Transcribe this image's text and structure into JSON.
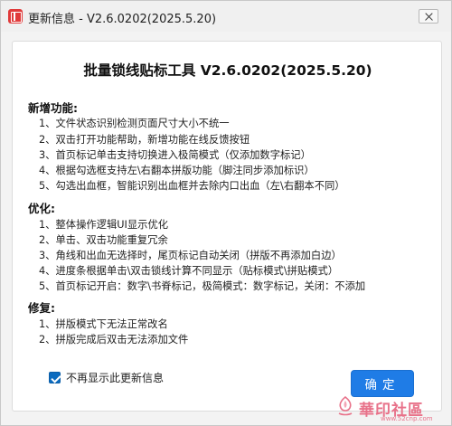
{
  "window": {
    "title": "更新信息 - V2.6.0202(2025.5.20)"
  },
  "heading": "批量锁线贴标工具 V2.6.0202(2025.5.20)",
  "sections": [
    {
      "title": "新增功能:",
      "items": [
        "1、文件状态识别检测页面尺寸大小不统一",
        "2、双击打开功能帮助，新增功能在线反馈按钮",
        "3、首页标记单击支持切换进入极简模式（仅添加数字标记）",
        "4、根据勾选框支持左\\右翻本拼版功能（脚注同步添加标识）",
        "5、勾选出血框，智能识别出血框并去除内口出血（左\\右翻本不同）"
      ]
    },
    {
      "title": "优化:",
      "items": [
        "1、整体操作逻辑UI显示优化",
        "2、单击、双击功能重复冗余",
        "3、角线和出血无选择时，尾页标记自动关闭（拼版不再添加白边）",
        "4、进度条根据单击\\双击锁线计算不同显示（贴标模式\\拼贴模式）",
        "5、首页标记开启：数字\\书脊标记，极简模式：数字标记，关闭：不添加"
      ]
    },
    {
      "title": "修复:",
      "items": [
        "1、拼版模式下无法正常改名",
        "2、拼版完成后双击无法添加文件"
      ]
    }
  ],
  "dont_show_again": {
    "label": "不再显示此更新信息",
    "checked": true
  },
  "ok_button": {
    "label": "确定"
  },
  "watermark": {
    "text": "華印社區",
    "url": "www.52cnp.com"
  },
  "colors": {
    "accent": "#1f7ce6",
    "app_icon": "#e03a3a",
    "watermark": "#e8728a"
  }
}
